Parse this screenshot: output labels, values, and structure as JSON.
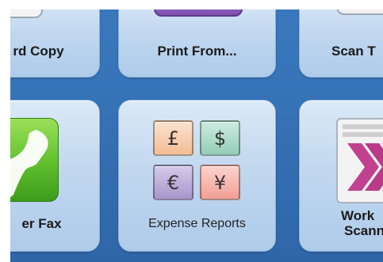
{
  "tiles": {
    "card_copy": {
      "label": "rd Copy"
    },
    "print_from": {
      "label": "Print From..."
    },
    "scan_to": {
      "label": "Scan T"
    },
    "server_fax": {
      "label": "er Fax"
    },
    "expense_reports": {
      "label": "Expense Reports"
    },
    "workflow_scanning": {
      "label_line1": "Work",
      "label_line2": "Scann"
    }
  },
  "currencies": [
    "£",
    "$",
    "€",
    "¥"
  ],
  "icons": {
    "card_copy": "card-copy-icon",
    "print_from": "print-from-icon",
    "scan_to": "scan-to-icon",
    "server_fax": "phone-handset-icon",
    "expense_reports": "currency-grid-icon",
    "workflow_scanning": "workflow-document-icon"
  },
  "colors": {
    "background": "#3570b4",
    "tile": "#c2d8ef",
    "pound": "#f5c9a8",
    "dollar": "#a6d7c6",
    "euro": "#b9a9d6",
    "yen": "#f5b2aa",
    "fax_green": "#6cc23a",
    "print_purple": "#8a57b8"
  }
}
